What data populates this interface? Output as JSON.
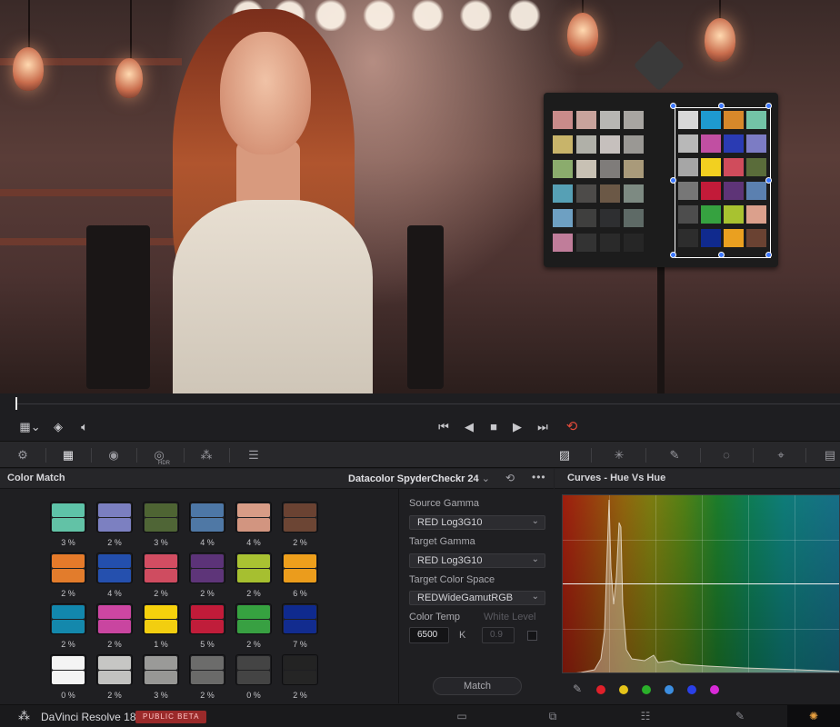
{
  "viewer": {
    "subject": ""
  },
  "transport": {
    "icons": [
      "viewer-options-icon",
      "layers-icon",
      "volume-icon",
      "go-to-start-icon",
      "step-back-icon",
      "stop-icon",
      "play-icon",
      "go-to-end-icon",
      "loop-icon"
    ]
  },
  "toolbar": {
    "left_tools": [
      "color-wheels-icon",
      "color-match-icon",
      "primaries-icon",
      "hdr-icon",
      "rgb-mixer-icon",
      "motion-effects-icon"
    ],
    "hdr_label": "HDR",
    "right_tools": [
      "curves-icon",
      "color-warper-icon",
      "qualifier-icon",
      "window-icon",
      "tracker-icon",
      "magic-mask-icon"
    ]
  },
  "color_match": {
    "title": "Color Match",
    "chart": "Datacolor SpyderCheckr 24",
    "swatches": [
      {
        "top": "#5ec3a8",
        "bottom": "#62c2a6",
        "pct": "3 %"
      },
      {
        "top": "#7b7fc0",
        "bottom": "#7c80c1",
        "pct": "2 %"
      },
      {
        "top": "#4e6433",
        "bottom": "#4f6536",
        "pct": "3 %"
      },
      {
        "top": "#4d77a6",
        "bottom": "#4f78a5",
        "pct": "4 %"
      },
      {
        "top": "#d89c86",
        "bottom": "#d29580",
        "pct": "4 %"
      },
      {
        "top": "#6a4232",
        "bottom": "#6c4534",
        "pct": "2 %"
      },
      {
        "top": "#e57a2a",
        "bottom": "#e27c2c",
        "pct": "2 %"
      },
      {
        "top": "#234fad",
        "bottom": "#2550ae",
        "pct": "4 %"
      },
      {
        "top": "#d24d62",
        "bottom": "#cf4c60",
        "pct": "2 %"
      },
      {
        "top": "#5c3378",
        "bottom": "#5e3579",
        "pct": "2 %"
      },
      {
        "top": "#a9c232",
        "bottom": "#a6bf30",
        "pct": "2 %"
      },
      {
        "top": "#ee9f1c",
        "bottom": "#eb9c1c",
        "pct": "6 %"
      },
      {
        "top": "#1287ad",
        "bottom": "#1488ac",
        "pct": "2 %"
      },
      {
        "top": "#cd46a2",
        "bottom": "#c945a0",
        "pct": "2 %"
      },
      {
        "top": "#f6d10c",
        "bottom": "#f2ce10",
        "pct": "1 %"
      },
      {
        "top": "#c21b39",
        "bottom": "#c01d3a",
        "pct": "5 %"
      },
      {
        "top": "#36a240",
        "bottom": "#38a042",
        "pct": "2 %"
      },
      {
        "top": "#0f2a8e",
        "bottom": "#122c8f",
        "pct": "7 %"
      },
      {
        "top": "#f4f4f4",
        "bottom": "#f4f4f4",
        "pct": "0 %"
      },
      {
        "top": "#c6c6c4",
        "bottom": "#c2c2c0",
        "pct": "2 %"
      },
      {
        "top": "#9a9a98",
        "bottom": "#979795",
        "pct": "3 %"
      },
      {
        "top": "#6c6c6b",
        "bottom": "#6a6a69",
        "pct": "2 %"
      },
      {
        "top": "#444444",
        "bottom": "#444444",
        "pct": "0 %"
      },
      {
        "top": "#232323",
        "bottom": "#252525",
        "pct": "2 %"
      }
    ],
    "source_gamma_label": "Source Gamma",
    "source_gamma": "RED Log3G10",
    "target_gamma_label": "Target Gamma",
    "target_gamma": "RED Log3G10",
    "target_color_space_label": "Target Color Space",
    "target_color_space": "REDWideGamutRGB",
    "color_temp_label": "Color Temp",
    "color_temp": "6500",
    "color_temp_unit": "K",
    "white_level_label": "White Level",
    "white_level": "0.9",
    "match_button": "Match"
  },
  "curves": {
    "title": "Curves - Hue Vs Hue",
    "swatch_colors": [
      "#e0202a",
      "#e6c41a",
      "#2ab02a",
      "#3c8ee0",
      "#2a40e8",
      "#d82ad8"
    ]
  },
  "bottom": {
    "app_name": "DaVinci Resolve 18",
    "beta_badge": "PUBLIC BETA",
    "pages": [
      "media-page-icon",
      "cut-page-icon",
      "edit-page-icon",
      "fusion-page-icon",
      "color-page-icon"
    ]
  }
}
